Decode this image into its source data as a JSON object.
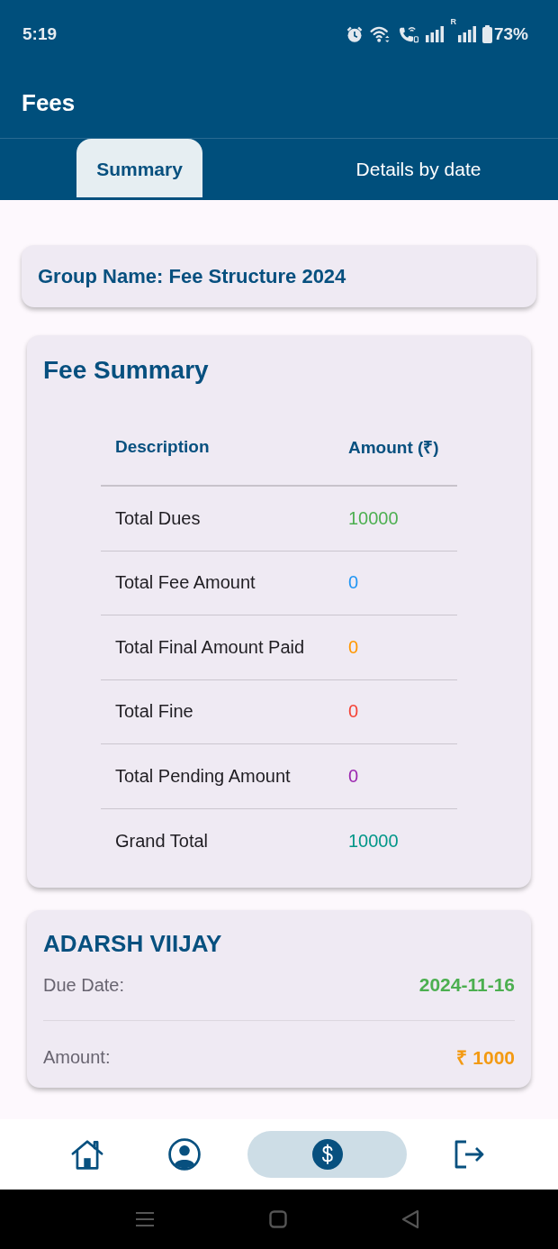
{
  "status_bar": {
    "time": "5:19",
    "roaming": "R",
    "battery": "73%"
  },
  "app_bar": {
    "title": "Fees"
  },
  "tabs": [
    {
      "label": "Summary",
      "selected": true
    },
    {
      "label": "Details by date",
      "selected": false
    }
  ],
  "group_card": {
    "text": "Group Name: Fee Structure 2024"
  },
  "fee_summary": {
    "title": "Fee Summary",
    "columns": [
      "Description",
      "Amount (₹)"
    ],
    "rows": [
      {
        "description": "Total Dues",
        "amount": "10000",
        "color": "#4caf50"
      },
      {
        "description": "Total Fee Amount",
        "amount": "0",
        "color": "#2196f3"
      },
      {
        "description": "Total Final Amount Paid",
        "amount": "0",
        "color": "#ff9800"
      },
      {
        "description": "Total Fine",
        "amount": "0",
        "color": "#f44336"
      },
      {
        "description": "Total Pending Amount",
        "amount": "0",
        "color": "#9c27b0"
      },
      {
        "description": "Grand Total",
        "amount": "10000",
        "color": "#009688"
      }
    ]
  },
  "student": {
    "name": "ADARSH VIIJAY",
    "fields": [
      {
        "label": "Due Date:",
        "value": "2024-11-16",
        "color": "#4caf50"
      },
      {
        "label": "Amount:",
        "value": "₹ 1000",
        "color": "#f39a12"
      }
    ]
  },
  "bottom_nav": [
    {
      "selected": false
    },
    {
      "selected": false
    },
    {
      "selected": true
    },
    {
      "selected": false
    }
  ]
}
